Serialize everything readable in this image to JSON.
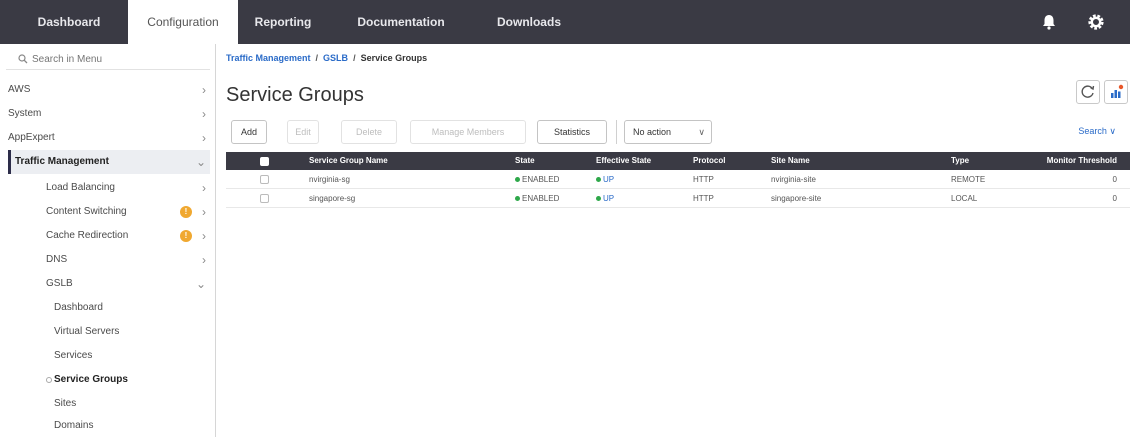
{
  "topnav": {
    "tabs": [
      {
        "label": "Dashboard"
      },
      {
        "label": "Configuration"
      },
      {
        "label": "Reporting"
      },
      {
        "label": "Documentation"
      },
      {
        "label": "Downloads"
      }
    ],
    "active_tab": "Configuration"
  },
  "sidebar": {
    "search_placeholder": "Search in Menu",
    "items": [
      {
        "label": "AWS"
      },
      {
        "label": "System"
      },
      {
        "label": "AppExpert"
      },
      {
        "label": "Traffic Management"
      },
      {
        "label": "Load Balancing"
      },
      {
        "label": "Content Switching",
        "badge": "!"
      },
      {
        "label": "Cache Redirection",
        "badge": "!"
      },
      {
        "label": "DNS"
      },
      {
        "label": "GSLB"
      },
      {
        "label": "Dashboard"
      },
      {
        "label": "Virtual Servers"
      },
      {
        "label": "Services"
      },
      {
        "label": "Service Groups"
      },
      {
        "label": "Sites"
      },
      {
        "label": "Domains"
      }
    ]
  },
  "breadcrumb": {
    "items": [
      "Traffic Management",
      "GSLB",
      "Service Groups"
    ],
    "separator": "/"
  },
  "page": {
    "title": "Service Groups"
  },
  "toolbar": {
    "add": "Add",
    "edit": "Edit",
    "delete": "Delete",
    "manage_members": "Manage Members",
    "statistics": "Statistics",
    "action_select": "No action",
    "search": "Search"
  },
  "table": {
    "columns": [
      "Service Group Name",
      "State",
      "Effective State",
      "Protocol",
      "Site Name",
      "Type",
      "Monitor Threshold"
    ],
    "rows": [
      {
        "name": "nvirginia-sg",
        "state": "ENABLED",
        "effective_state": "UP",
        "protocol": "HTTP",
        "site_name": "nvirginia-site",
        "type": "REMOTE",
        "monitor_threshold": "0"
      },
      {
        "name": "singapore-sg",
        "state": "ENABLED",
        "effective_state": "UP",
        "protocol": "HTTP",
        "site_name": "singapore-site",
        "type": "LOCAL",
        "monitor_threshold": "0"
      }
    ]
  },
  "colors": {
    "nav_bg": "#3a3a44",
    "link": "#2a6bc8",
    "status_green": "#2ea84a",
    "badge": "#f0a830"
  }
}
